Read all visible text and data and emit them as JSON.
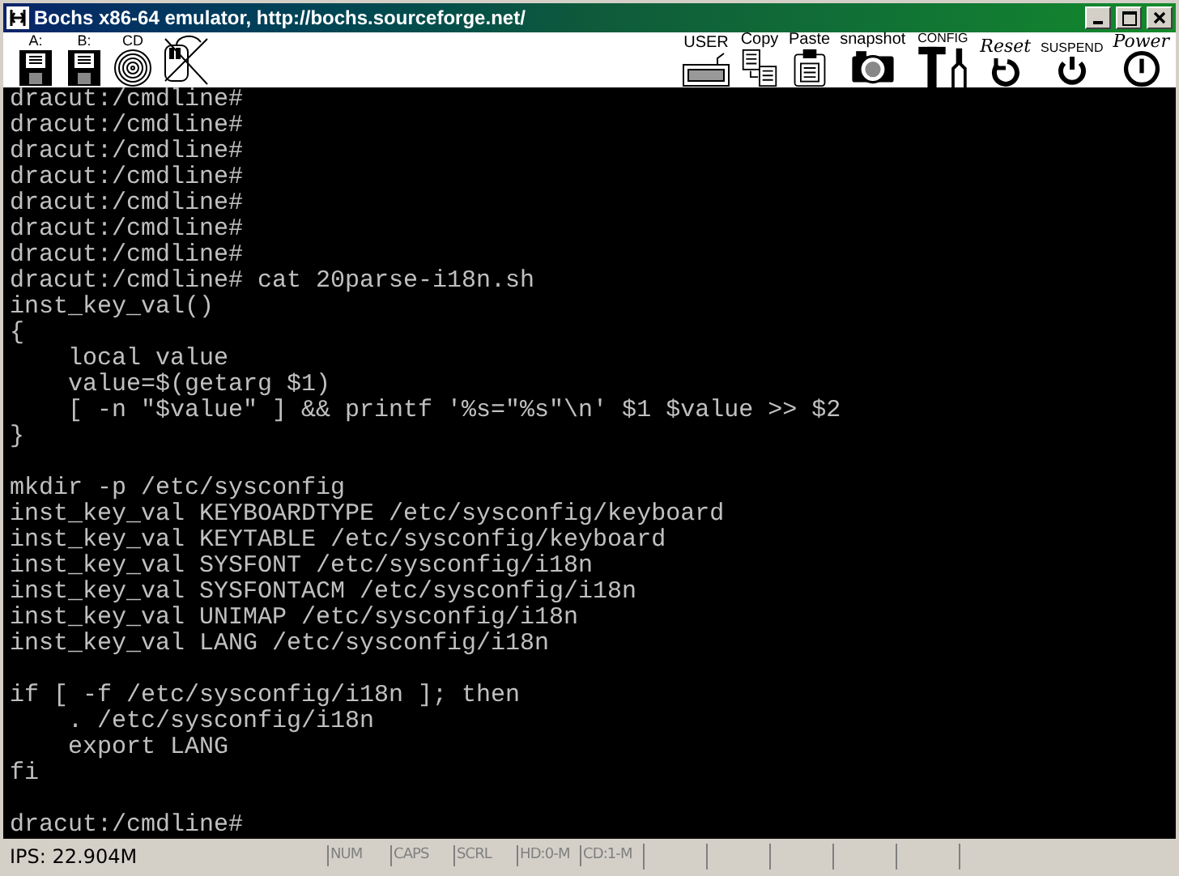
{
  "window": {
    "title": "Bochs x86-64 emulator, http://bochs.sourceforge.net/"
  },
  "toolbar": {
    "left": [
      {
        "kind": "floppy",
        "label": "A:"
      },
      {
        "kind": "floppy",
        "label": "B:"
      },
      {
        "kind": "cdrom",
        "label": "CD"
      },
      {
        "kind": "mouse"
      }
    ],
    "right": [
      {
        "kind": "keyboard",
        "label": "USER"
      },
      {
        "kind": "copy",
        "label": "Copy"
      },
      {
        "kind": "paste",
        "label": "Paste"
      },
      {
        "kind": "camera",
        "label": "snapshot"
      },
      {
        "kind": "config",
        "label": "CONFIG"
      },
      {
        "kind": "reset",
        "label": "Reset"
      },
      {
        "kind": "suspend",
        "label": "SUSPEND"
      },
      {
        "kind": "power",
        "label": "Power"
      }
    ]
  },
  "terminal": {
    "blocks": [
      [
        "dracut:/cmdline#",
        "dracut:/cmdline#",
        "dracut:/cmdline#",
        "dracut:/cmdline#",
        "dracut:/cmdline#",
        "dracut:/cmdline#",
        "dracut:/cmdline#",
        "dracut:/cmdline# cat 20parse-i18n.sh",
        "inst_key_val()",
        "{",
        "    local value",
        "    value=$(getarg $1)",
        "    [ -n \"$value\" ] && printf '%s=\"%s\"\\n' $1 $value >> $2",
        "}"
      ],
      [
        "mkdir -p /etc/sysconfig",
        "inst_key_val KEYBOARDTYPE /etc/sysconfig/keyboard",
        "inst_key_val KEYTABLE /etc/sysconfig/keyboard",
        "inst_key_val SYSFONT /etc/sysconfig/i18n",
        "inst_key_val SYSFONTACM /etc/sysconfig/i18n",
        "inst_key_val UNIMAP /etc/sysconfig/i18n",
        "inst_key_val LANG /etc/sysconfig/i18n"
      ],
      [
        "if [ -f /etc/sysconfig/i18n ]; then",
        "    . /etc/sysconfig/i18n",
        "    export LANG",
        "fi"
      ],
      [
        "dracut:/cmdline#"
      ]
    ]
  },
  "status_bar": {
    "ips": "IPS: 22.904M",
    "indicators": [
      {
        "label": "NUM",
        "on": false
      },
      {
        "label": "CAPS",
        "on": false
      },
      {
        "label": "SCRL",
        "on": false
      },
      {
        "label": "HD:0-M",
        "on": false
      },
      {
        "label": "CD:1-M",
        "on": false
      }
    ]
  }
}
